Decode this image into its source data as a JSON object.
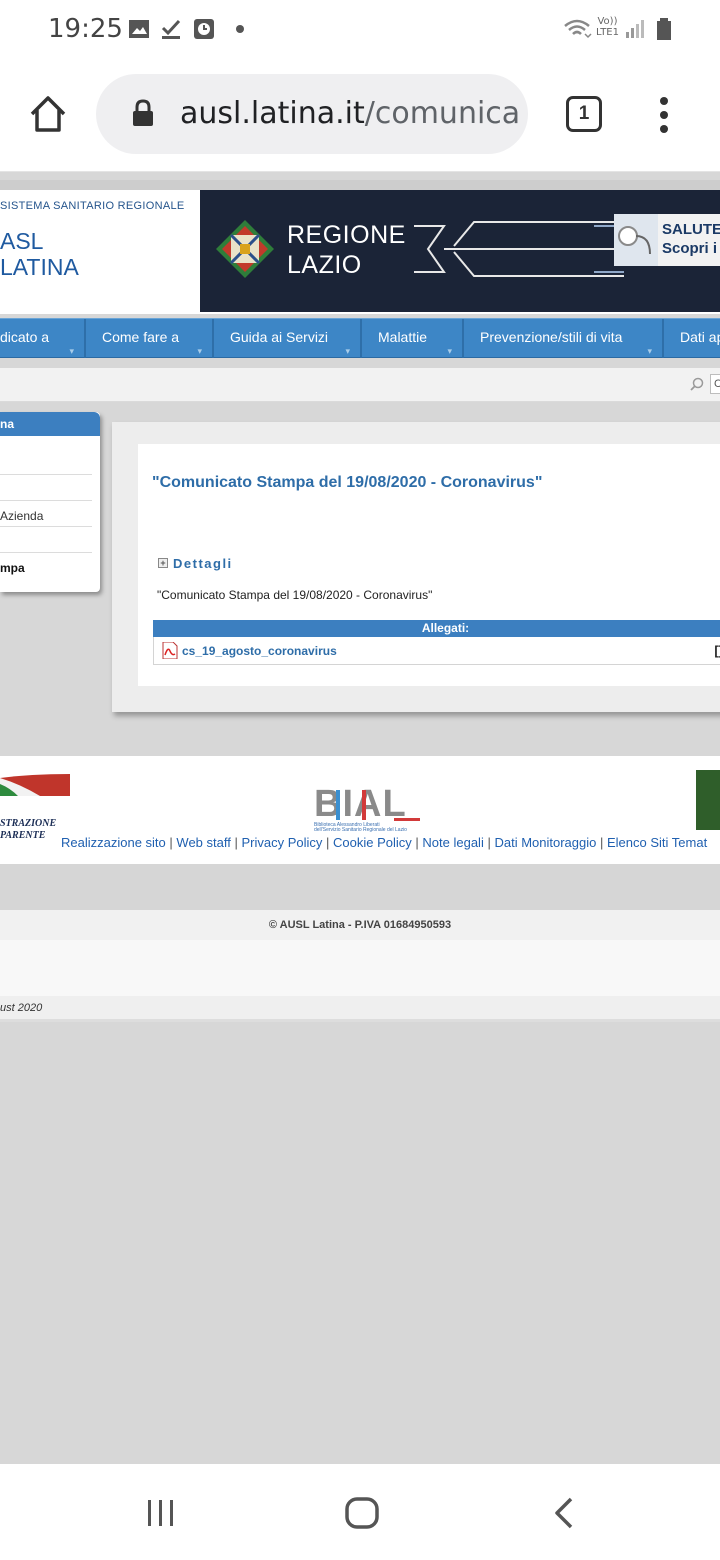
{
  "status": {
    "time": "19:25",
    "network_label_top": "Vo))",
    "network_label_bottom": "LTE1"
  },
  "browser": {
    "url_domain": "ausl.latina.it",
    "url_path": "/comunica",
    "tab_count": "1"
  },
  "header": {
    "ssr_label": "SISTEMA SANITARIO REGIONALE",
    "asl_line1": "ASL",
    "asl_line2": "LATINA",
    "regione_line1": "REGIONE",
    "regione_line2": "LAZIO",
    "promo_line1": "SALUTEI",
    "promo_line2": "Scopri i"
  },
  "nav": {
    "items": [
      {
        "label": "dicato a"
      },
      {
        "label": "Come fare a"
      },
      {
        "label": "Guida ai Servizi"
      },
      {
        "label": "Malattie"
      },
      {
        "label": "Prevenzione/stili di vita"
      },
      {
        "label": "Dati ap"
      }
    ]
  },
  "search": {
    "stub": "C"
  },
  "sidebar": {
    "header": "na",
    "items": [
      {
        "label": ""
      },
      {
        "label": ""
      },
      {
        "label": "Azienda"
      },
      {
        "label": ""
      },
      {
        "label": "mpa"
      }
    ]
  },
  "article": {
    "title": "\"Comunicato Stampa del 19/08/2020 - Coronavirus\"",
    "dettagli_label": "Dettagli",
    "description": "\"Comunicato Stampa del 19/08/2020 - Coronavirus\"",
    "allegati_label": "Allegati:",
    "attachment_name": "cs_19_agosto_coronavirus",
    "attachment_bracket": "[]"
  },
  "footer": {
    "amm_line1": "STRAZIONE",
    "amm_line2": "PARENTE",
    "bial_text": "BIAL",
    "bial_caption_1": "Biblioteca Alessandro Liberati",
    "bial_caption_2": "dell'Servizio Sanitario Regionale del Lazio",
    "links": [
      "Realizzazione sito",
      "Web staff",
      "Privacy Policy",
      "Cookie Policy",
      "Note legali",
      "Dati Monitoraggio",
      "Elenco Siti Temat"
    ],
    "copyright": "© AUSL Latina - P.IVA 01684950593",
    "date_fragment": "ust 2020"
  },
  "colors": {
    "nav_blue": "#3d86c6",
    "link_blue": "#2e6da8",
    "banner_navy": "#1b2437"
  }
}
